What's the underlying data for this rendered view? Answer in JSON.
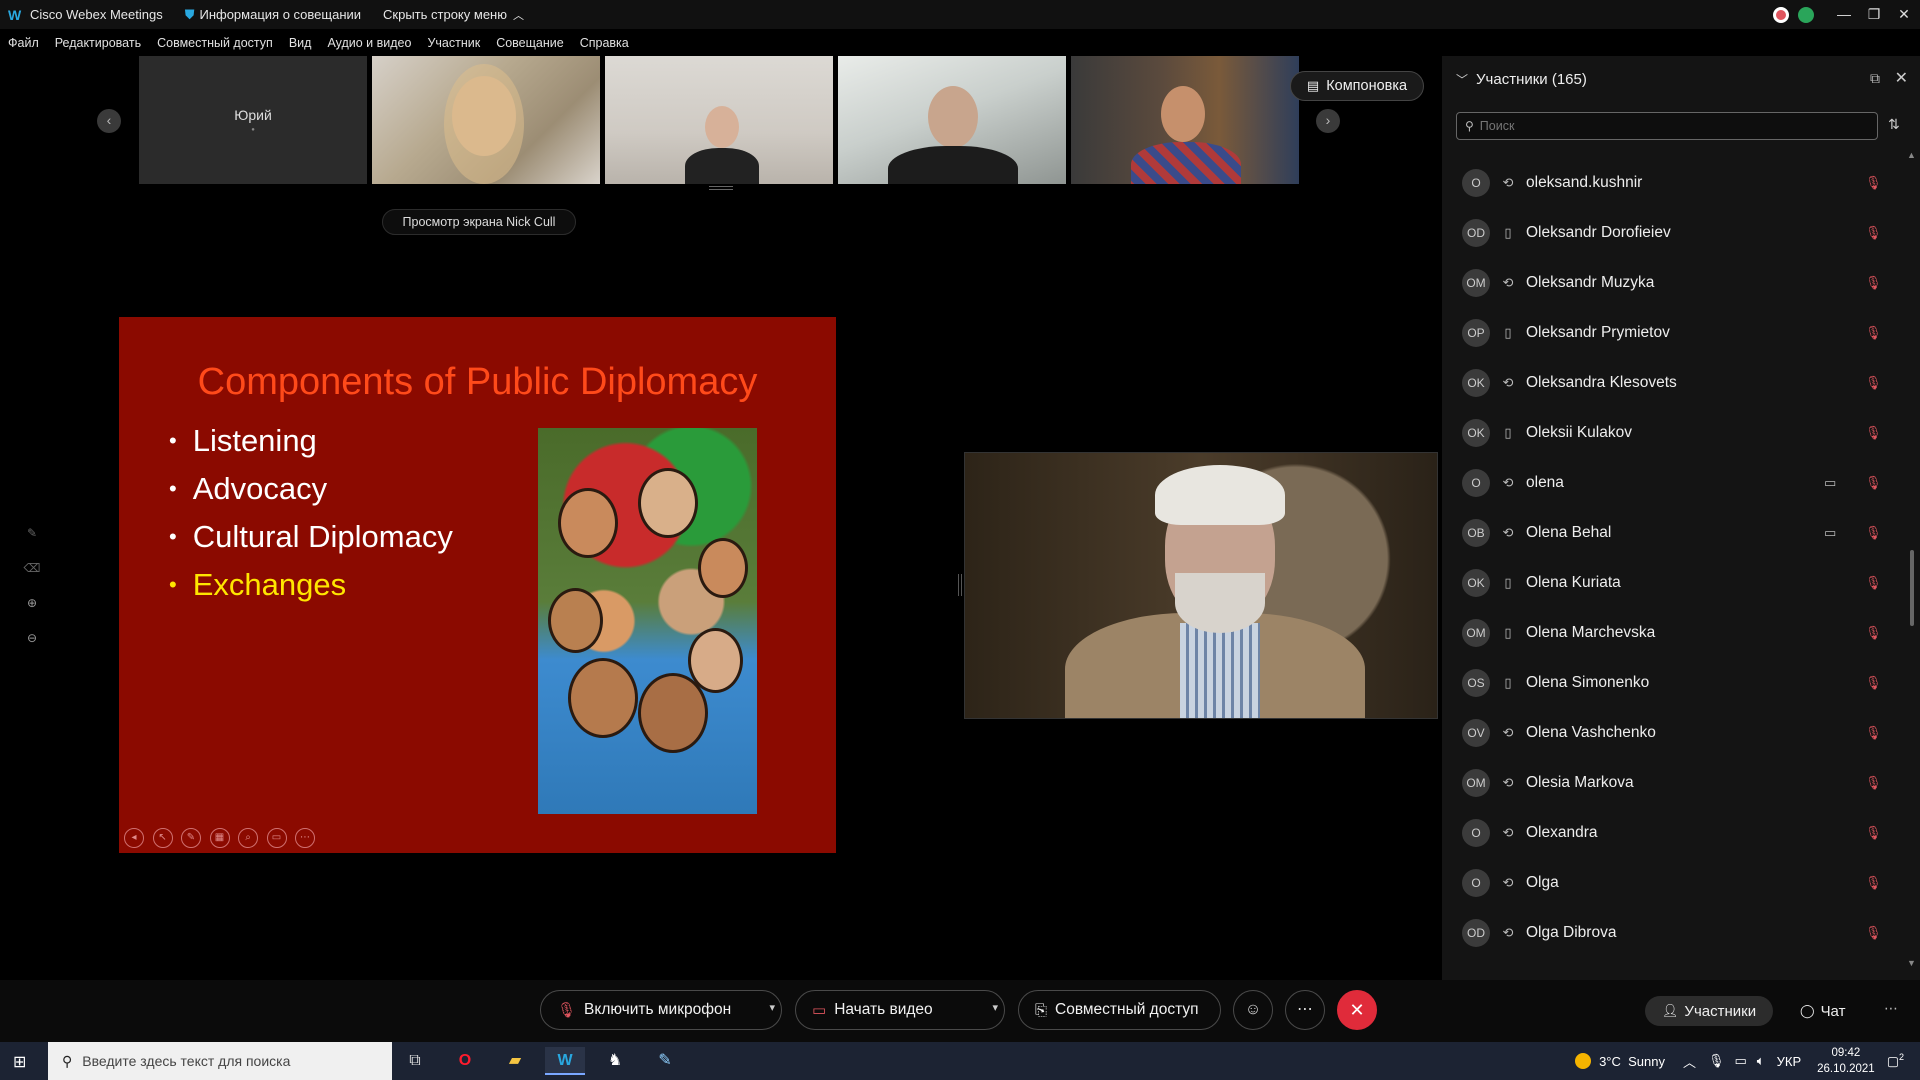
{
  "titlebar": {
    "app_name": "Cisco Webex Meetings",
    "meeting_info": "Информация о совещании",
    "hide_menu": "Скрыть строку меню",
    "minimize": "—",
    "maximize": "❐",
    "close": "✕"
  },
  "menu": [
    "Файл",
    "Редактировать",
    "Совместный доступ",
    "Вид",
    "Аудио и видео",
    "Участник",
    "Совещание",
    "Справка"
  ],
  "thumbnails": {
    "first_name": "Юрий"
  },
  "layout_button": "Компоновка",
  "share_label": "Просмотр экрана Nick Cull",
  "slide": {
    "title": "Components of Public Diplomacy",
    "bullets": [
      {
        "text": "Listening",
        "highlight": false
      },
      {
        "text": "Advocacy",
        "highlight": false
      },
      {
        "text": "Cultural Diplomacy",
        "highlight": false
      },
      {
        "text": "Exchanges",
        "highlight": true
      }
    ],
    "bg_color": "#8b0a00",
    "title_color": "#ff4a1a",
    "highlight_color": "#ffe600"
  },
  "panel": {
    "title": "Участники (165)",
    "search_placeholder": "Поиск",
    "participants": [
      {
        "initials": "O",
        "name": "oleksand.kushnir",
        "device": "phone",
        "camera": false
      },
      {
        "initials": "OD",
        "name": "Oleksandr Dorofieiev",
        "device": "mobile",
        "camera": false
      },
      {
        "initials": "OM",
        "name": "Oleksandr Muzyka",
        "device": "phone",
        "camera": false
      },
      {
        "initials": "OP",
        "name": "Oleksandr Prymietov",
        "device": "mobile",
        "camera": false
      },
      {
        "initials": "OK",
        "name": "Oleksandra Klesovets",
        "device": "phone",
        "camera": false
      },
      {
        "initials": "OK",
        "name": "Oleksii Kulakov",
        "device": "mobile",
        "camera": false
      },
      {
        "initials": "O",
        "name": "olena",
        "device": "phone",
        "camera": true
      },
      {
        "initials": "OB",
        "name": "Olena Behal",
        "device": "phone",
        "camera": true
      },
      {
        "initials": "OK",
        "name": "Olena Kuriata",
        "device": "mobile",
        "camera": false
      },
      {
        "initials": "OM",
        "name": "Olena Marchevska",
        "device": "mobile",
        "camera": false
      },
      {
        "initials": "OS",
        "name": "Olena Simonenko",
        "device": "mobile",
        "camera": false
      },
      {
        "initials": "OV",
        "name": "Olena Vashchenko",
        "device": "phone",
        "camera": false
      },
      {
        "initials": "OM",
        "name": "Olesia Markova",
        "device": "phone",
        "camera": false
      },
      {
        "initials": "O",
        "name": "Olexandra",
        "device": "phone",
        "camera": false
      },
      {
        "initials": "O",
        "name": "Olga",
        "device": "phone",
        "camera": false
      },
      {
        "initials": "OD",
        "name": "Olga Dibrova",
        "device": "phone",
        "camera": false
      }
    ]
  },
  "controls": {
    "mic": "Включить микрофон",
    "video": "Начать видео",
    "share": "Совместный доступ",
    "participants_tab": "Участники",
    "chat_tab": "Чат"
  },
  "taskbar": {
    "search_placeholder": "Введите здесь текст для поиска",
    "weather": "3°C  Sunny",
    "lang": "УКР",
    "time": "09:42",
    "date": "26.10.2021",
    "notifications": "2"
  },
  "colors": {
    "accent": "#29a8e0",
    "mic_muted": "#e0555e",
    "end_call": "#e02b3a"
  }
}
